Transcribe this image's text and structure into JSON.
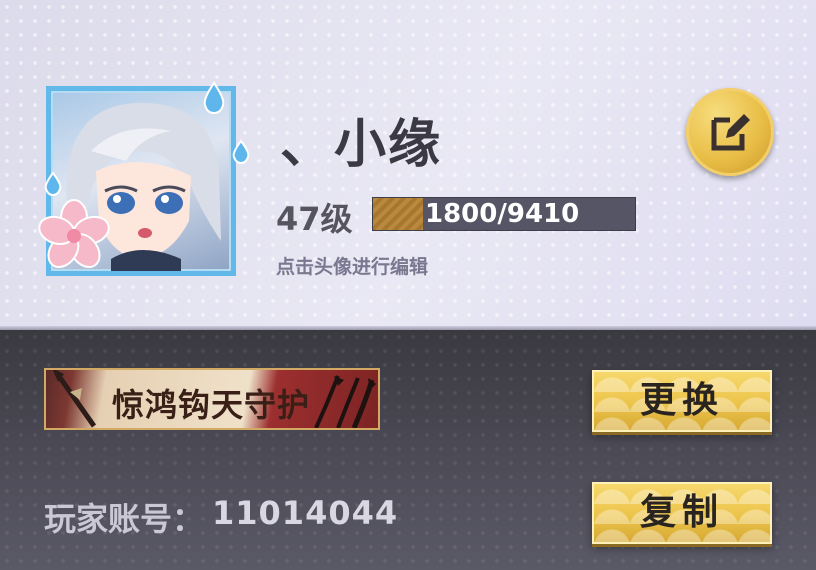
{
  "profile": {
    "player_name": "、小缘",
    "level": "47级",
    "exp_text": "1800/9410",
    "exp_progress": 0.191,
    "avatar_hint": "点击头像进行编辑"
  },
  "icons": {
    "avatar": "character-portrait",
    "edit": "edit-icon",
    "flower": "cherry-blossom-icon",
    "droplet": "water-drop-icon"
  },
  "title": {
    "name": "惊鸿钩天守护",
    "change_label": "更换"
  },
  "account": {
    "label": "玩家账号：",
    "id": "11014044",
    "copy_label": "复制"
  },
  "colors": {
    "accent_gold": "#ecc44a",
    "avatar_frame": "#62b8e8",
    "exp_fill": "#b98a3e"
  }
}
